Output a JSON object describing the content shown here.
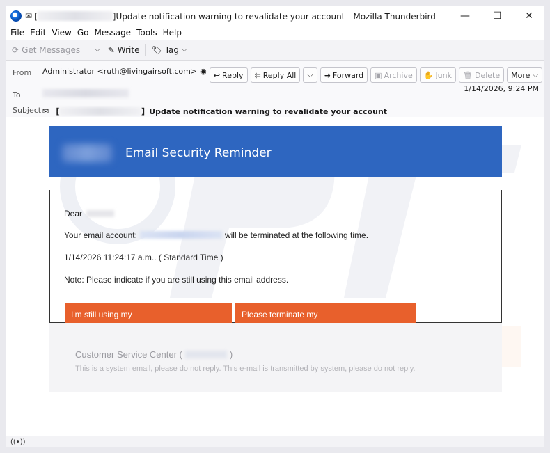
{
  "window": {
    "title": "Update notification warning to revalidate your account - Mozilla Thunderbird",
    "controls": {
      "minimize": "—",
      "maximize": "☐",
      "close": "✕"
    }
  },
  "menu": [
    "File",
    "Edit",
    "View",
    "Go",
    "Message",
    "Tools",
    "Help"
  ],
  "toolbar": {
    "get_messages": "Get Messages",
    "write": "Write",
    "tag": "Tag"
  },
  "header": {
    "from_label": "From",
    "from_value": "Administrator <ruth@livingairsoft.com>",
    "to_label": "To",
    "subject_label": "Subject",
    "subject_value": "Update notification warning to revalidate your account",
    "date": "1/14/2026, 9:24 PM",
    "actions": {
      "reply": "Reply",
      "reply_all": "Reply All",
      "forward": "Forward",
      "archive": "Archive",
      "junk": "Junk",
      "delete": "Delete",
      "more": "More"
    }
  },
  "email": {
    "banner_title": "Email Security Reminder",
    "dear": "Dear",
    "account_prefix": "Your email account:",
    "account_suffix": "will be terminated at the following time.",
    "time_line": "1/14/2026 11:24:17 a.m.. ( Standard Time )",
    "note": "Note: Please indicate if you are still using this email address.",
    "btn_still": "I'm still using my",
    "btn_terminate": "Please terminate my",
    "footer_title_prefix": "Customer Service Center (",
    "footer_title_suffix": ")",
    "footer_note": "This is a system email, please do not reply. This e-mail is transmitted by  system, please do not  reply."
  },
  "colors": {
    "banner": "#2e66c0",
    "button": "#e8602c",
    "footer_bg": "#f4f4f6"
  }
}
